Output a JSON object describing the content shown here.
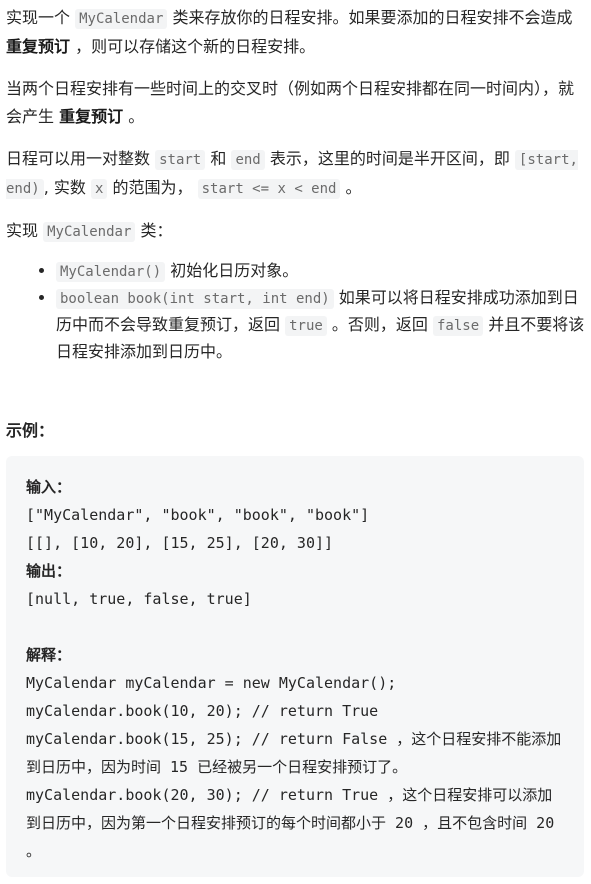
{
  "intro": {
    "t1": "实现一个 ",
    "c1": "MyCalendar",
    "t2": " 类来存放你的日程安排。如果要添加的日程安排不会造成 ",
    "b1": "重复预订",
    "t3": " ，则可以存储这个新的日程安排。"
  },
  "overlap": {
    "t1": "当两个日程安排有一些时间上的交叉时（例如两个日程安排都在同一时间内），就会产生 ",
    "b1": "重复预订",
    "t2": " 。"
  },
  "range": {
    "t1": "日程可以用一对整数 ",
    "c1": "start",
    "t2": " 和 ",
    "c2": "end",
    "t3": " 表示，这里的时间是半开区间，即 ",
    "c3": "[start, end)",
    "t4": ", 实数 ",
    "c4": "x",
    "t5": " 的范围为，  ",
    "c5": "start <= x < end",
    "t6": " 。"
  },
  "impl": {
    "t1": "实现 ",
    "c1": "MyCalendar",
    "t2": " 类："
  },
  "methods": [
    {
      "code": "MyCalendar()",
      "text": " 初始化日历对象。"
    },
    {
      "code": "boolean book(int start, int end)",
      "text1": " 如果可以将日程安排成功添加到日历中而不会导致重复预订，返回 ",
      "code2": "true",
      "text2": " 。否则，返回 ",
      "code3": "false",
      "text3": " 并且不要将该日程安排添加到日历中。"
    }
  ],
  "example": {
    "title": "示例：",
    "input_label": "输入：",
    "input_line1": "[\"MyCalendar\", \"book\", \"book\", \"book\"]",
    "input_line2": "[[], [10, 20], [15, 25], [20, 30]]",
    "output_label": "输出：",
    "output_line": "[null, true, false, true]",
    "explain_label": "解释：",
    "explain_lines": [
      "MyCalendar myCalendar = new MyCalendar();",
      "myCalendar.book(10, 20); // return True",
      "myCalendar.book(15, 25); // return False ，这个日程安排不能添加到日历中，因为时间 15 已经被另一个日程安排预订了。",
      "myCalendar.book(20, 30); // return True ，这个日程安排可以添加到日历中，因为第一个日程安排预订的每个时间都小于 20 ，且不包含时间 20 。"
    ]
  }
}
